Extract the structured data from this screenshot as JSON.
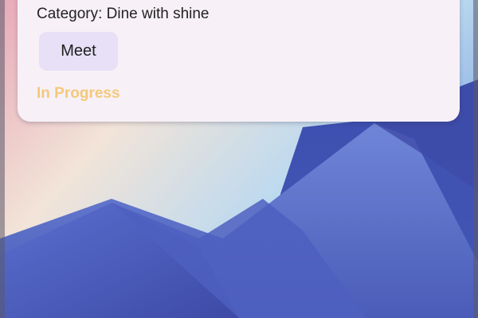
{
  "task_card": {
    "category_text": "Category: Dine with shine",
    "tag_label": "Meet",
    "status_text": "In Progress"
  },
  "colors": {
    "card_background": "#f7f1f7",
    "tag_background": "#e7e0f6",
    "status_color": "#f5c87a"
  },
  "wallpaper": {
    "description_icon": "mountain-wallpaper"
  }
}
